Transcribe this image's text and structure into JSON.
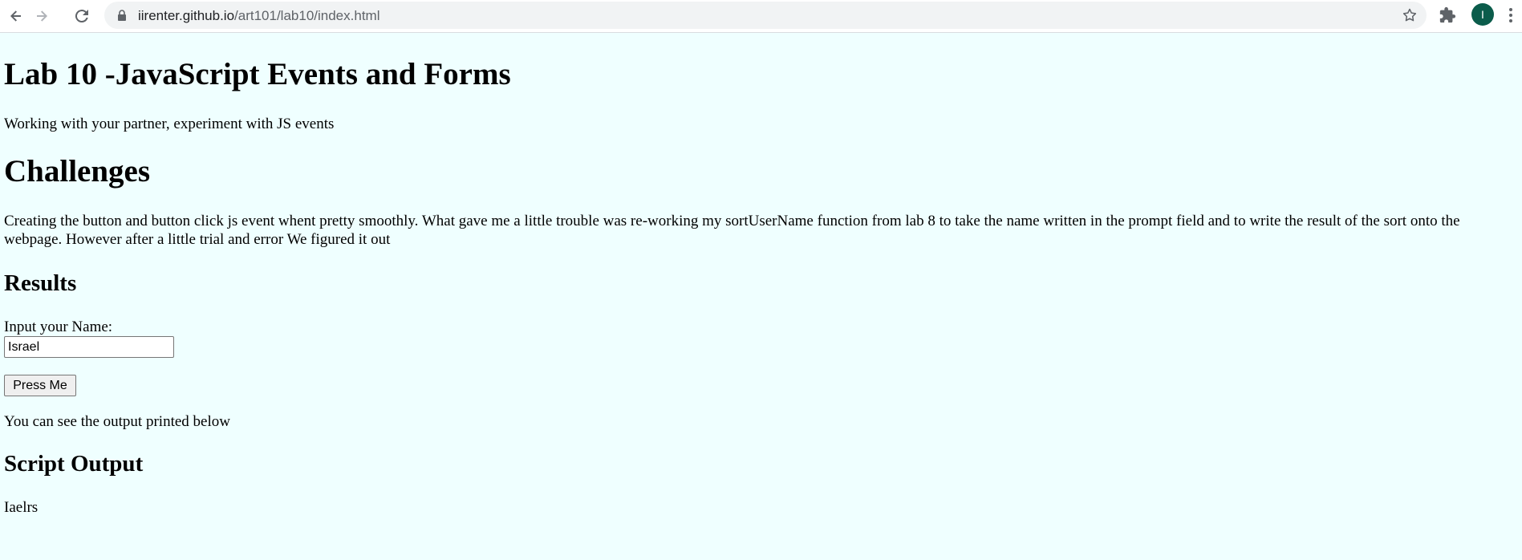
{
  "browser": {
    "url_host": "iirenter.github.io",
    "url_path": "/art101/lab10/index.html",
    "avatar_letter": "I",
    "icons": [
      "back-icon",
      "forward-icon",
      "reload-icon",
      "lock-icon",
      "star-icon",
      "extensions-icon",
      "menu-icon"
    ]
  },
  "page": {
    "title": "Lab 10 -JavaScript Events and Forms",
    "intro": "Working with your partner, experiment with JS events",
    "challenges_heading": "Challenges",
    "challenges_text": "Creating the button and button click js event whent pretty smoothly. What gave me a little trouble was re-working my sortUserName function from lab 8 to take the name written in the prompt field and to write the result of the sort onto the webpage. However after a little trial and error We figured it out",
    "results_heading": "Results",
    "input_label": "Input your Name:",
    "input_value": "Israel",
    "button_label": "Press Me",
    "output_note": "You can see the output printed below",
    "script_output_heading": "Script Output",
    "script_output_text": "Iaelrs"
  },
  "colors": {
    "page_background": "#efffff",
    "avatar_background": "#0b5c4b"
  }
}
